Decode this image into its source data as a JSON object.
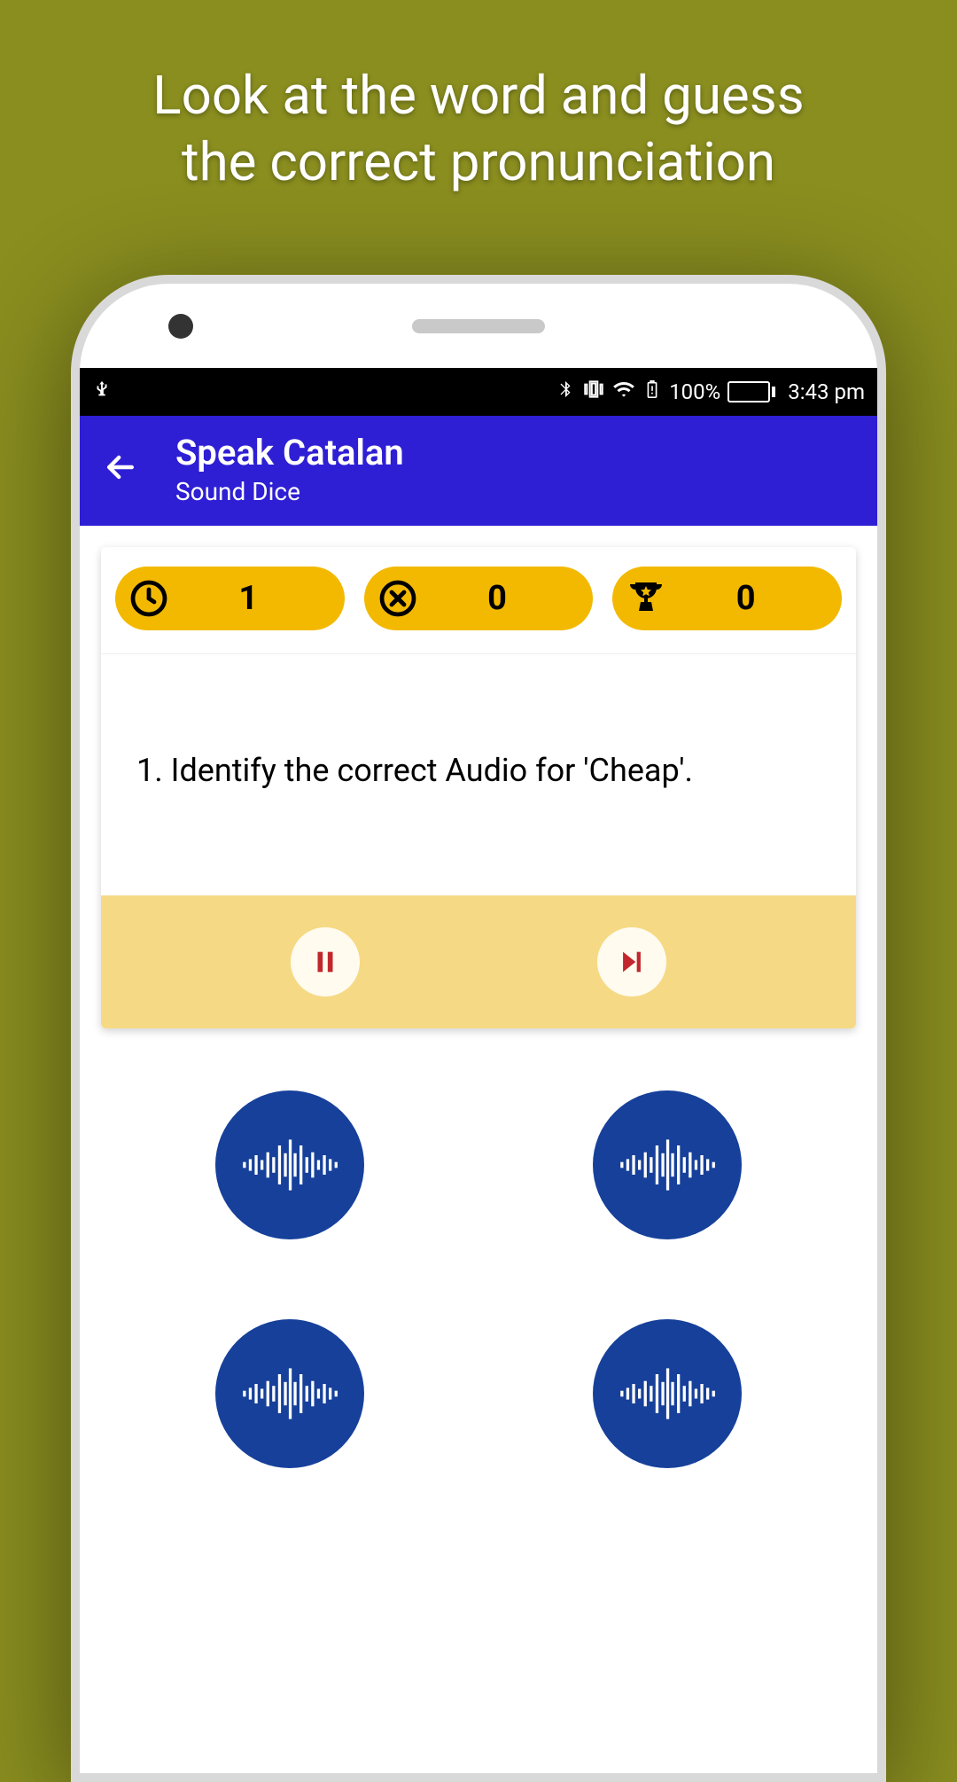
{
  "promo": {
    "line1": "Look at the word and guess",
    "line2": "the correct pronunciation"
  },
  "status": {
    "battery_pct": "100%",
    "time": "3:43 pm"
  },
  "appbar": {
    "title": "Speak Catalan",
    "subtitle": "Sound Dice"
  },
  "stats": {
    "time_value": "1",
    "wrong_value": "0",
    "score_value": "0"
  },
  "question": {
    "text": "1. Identify the correct Audio for 'Cheap'."
  },
  "icons": {
    "back": "back-arrow",
    "clock": "clock-icon",
    "wrong": "x-circle-icon",
    "trophy": "trophy-icon",
    "pause": "pause-icon",
    "next": "skip-next-icon",
    "wave": "waveform-icon",
    "usb": "usb-icon",
    "bt": "bluetooth-icon",
    "vib": "vibrate-icon",
    "wifi": "wifi-icon",
    "batwarn": "battery-warn-icon"
  },
  "colors": {
    "bg": "#8a8e1f",
    "appbar": "#2e1fd4",
    "pill": "#f3b900",
    "controls_bg": "#f6d985",
    "audio_btn": "#16409a",
    "ctrl_accent": "#c1272d"
  }
}
